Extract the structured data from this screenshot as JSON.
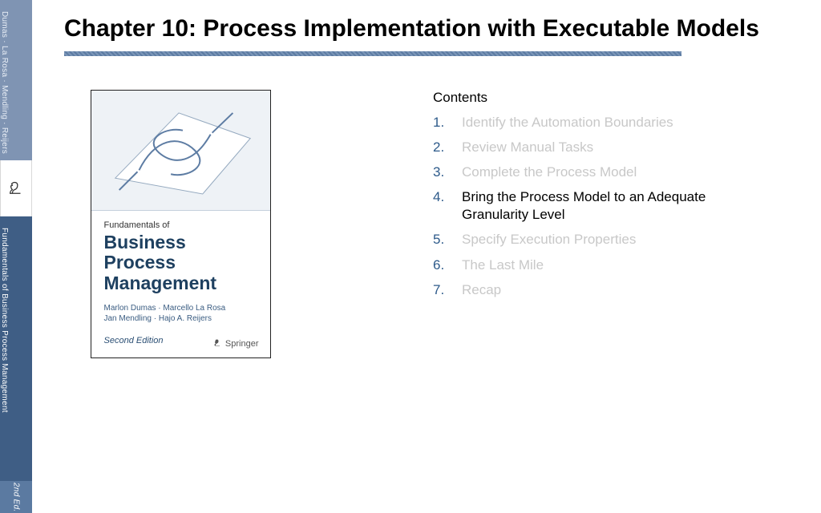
{
  "spine": {
    "authors": "Dumas · La Rosa · Mendling · Reijers",
    "title": "Fundamentals of Business Process Management",
    "edition": "2nd Ed.",
    "icon": "knight-icon"
  },
  "slide": {
    "title": "Chapter 10: Process Implementation with Executable Models"
  },
  "cover": {
    "supertitle": "Fundamentals of",
    "title": "Business Process Management",
    "authors_line1": "Marlon Dumas · Marcello La Rosa",
    "authors_line2": "Jan Mendling · Hajo A. Reijers",
    "edition": "Second Edition",
    "publisher": "Springer"
  },
  "contents": {
    "heading": "Contents",
    "active_index": 3,
    "items": [
      {
        "num": "1.",
        "label": "Identify the Automation Boundaries"
      },
      {
        "num": "2.",
        "label": "Review Manual Tasks"
      },
      {
        "num": "3.",
        "label": "Complete the Process Model"
      },
      {
        "num": "4.",
        "label": "Bring the Process Model to an Adequate Granularity Level"
      },
      {
        "num": "5.",
        "label": "Specify Execution Properties"
      },
      {
        "num": "6.",
        "label": "The Last Mile"
      },
      {
        "num": "7.",
        "label": "Recap"
      }
    ]
  }
}
